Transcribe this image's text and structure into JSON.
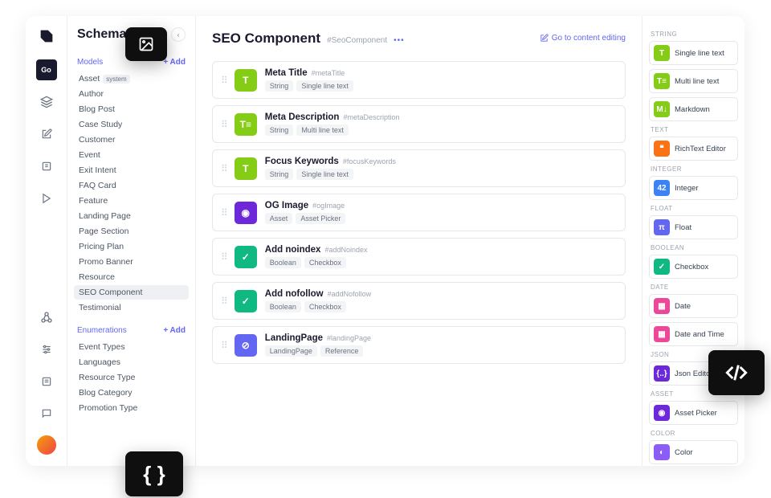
{
  "rail": {
    "active_label": "Go"
  },
  "sidebar": {
    "title": "Schema",
    "models_label": "Models",
    "models_add": "+ Add",
    "models": [
      {
        "label": "Asset",
        "system": "system"
      },
      {
        "label": "Author"
      },
      {
        "label": "Blog Post"
      },
      {
        "label": "Case Study"
      },
      {
        "label": "Customer"
      },
      {
        "label": "Event"
      },
      {
        "label": "Exit Intent"
      },
      {
        "label": "FAQ Card"
      },
      {
        "label": "Feature"
      },
      {
        "label": "Landing Page"
      },
      {
        "label": "Page Section"
      },
      {
        "label": "Pricing Plan"
      },
      {
        "label": "Promo Banner"
      },
      {
        "label": "Resource"
      },
      {
        "label": "SEO Component",
        "selected": true
      },
      {
        "label": "Testimonial"
      }
    ],
    "enums_label": "Enumerations",
    "enums_add": "+ Add",
    "enums": [
      {
        "label": "Event Types"
      },
      {
        "label": "Languages"
      },
      {
        "label": "Resource Type"
      },
      {
        "label": "Blog Category"
      },
      {
        "label": "Promotion Type"
      }
    ]
  },
  "main": {
    "title": "SEO Component",
    "api_id": "#SeoComponent",
    "content_link": "Go to content editing",
    "fields": [
      {
        "name": "Meta Title",
        "api": "#metaTitle",
        "tags": [
          "String",
          "Single line text"
        ],
        "color": "bg-green",
        "glyph": "T"
      },
      {
        "name": "Meta Description",
        "api": "#metaDescription",
        "tags": [
          "String",
          "Multi line text"
        ],
        "color": "bg-green",
        "glyph": "T≡"
      },
      {
        "name": "Focus Keywords",
        "api": "#focusKeywords",
        "tags": [
          "String",
          "Single line text"
        ],
        "color": "bg-green",
        "glyph": "T"
      },
      {
        "name": "OG Image",
        "api": "#ogImage",
        "tags": [
          "Asset",
          "Asset Picker"
        ],
        "color": "bg-purple",
        "glyph": "◉"
      },
      {
        "name": "Add noindex",
        "api": "#addNoindex",
        "tags": [
          "Boolean",
          "Checkbox"
        ],
        "color": "bg-teal",
        "glyph": "✓"
      },
      {
        "name": "Add nofollow",
        "api": "#addNofollow",
        "tags": [
          "Boolean",
          "Checkbox"
        ],
        "color": "bg-teal",
        "glyph": "✓"
      },
      {
        "name": "LandingPage",
        "api": "#landingPage",
        "tags": [
          "LandingPage",
          "Reference"
        ],
        "color": "bg-indigo",
        "glyph": "⊘"
      }
    ]
  },
  "palette": {
    "sections": [
      {
        "label": "String",
        "items": [
          {
            "label": "Single line text",
            "color": "bg-green",
            "glyph": "T"
          },
          {
            "label": "Multi line text",
            "color": "bg-green",
            "glyph": "T≡"
          },
          {
            "label": "Markdown",
            "color": "bg-green",
            "glyph": "M↓"
          }
        ]
      },
      {
        "label": "Text",
        "items": [
          {
            "label": "RichText Editor",
            "color": "bg-orange",
            "glyph": "❝"
          }
        ]
      },
      {
        "label": "Integer",
        "items": [
          {
            "label": "Integer",
            "color": "bg-blue",
            "glyph": "42"
          }
        ]
      },
      {
        "label": "Float",
        "items": [
          {
            "label": "Float",
            "color": "bg-indigo",
            "glyph": "π"
          }
        ]
      },
      {
        "label": "Boolean",
        "items": [
          {
            "label": "Checkbox",
            "color": "bg-teal",
            "glyph": "✓"
          }
        ]
      },
      {
        "label": "Date",
        "items": [
          {
            "label": "Date",
            "color": "bg-pink",
            "glyph": "▦"
          },
          {
            "label": "Date and Time",
            "color": "bg-pink",
            "glyph": "▦"
          }
        ]
      },
      {
        "label": "JSON",
        "items": [
          {
            "label": "Json Editor",
            "color": "bg-purple",
            "glyph": "{..}"
          }
        ]
      },
      {
        "label": "Asset",
        "items": [
          {
            "label": "Asset Picker",
            "color": "bg-purple",
            "glyph": "◉"
          }
        ]
      },
      {
        "label": "Color",
        "items": [
          {
            "label": "Color",
            "color": "bg-violet",
            "glyph": "◐"
          }
        ]
      }
    ]
  }
}
